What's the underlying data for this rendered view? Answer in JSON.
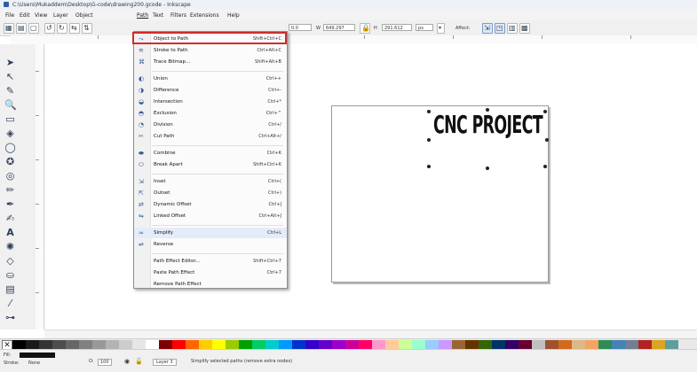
{
  "window": {
    "title": "C:\\Users\\Mukaddem\\Desktop\\G-code\\drawing200.gcode - Inkscape"
  },
  "menubar": [
    "File",
    "Edit",
    "View",
    "Layer",
    "Object",
    "Path",
    "Text",
    "Filters",
    "Extensions",
    "Help"
  ],
  "toolbar": {
    "x_value": "0.0",
    "w_label": "W",
    "w_value": "649.297",
    "h_label": "H",
    "h_value": "291.612",
    "unit": "px",
    "affect_label": "Affect:"
  },
  "path_menu": [
    {
      "label": "Object to Path",
      "shortcut": "Shift+Ctrl+C",
      "icon": "object-to-path-icon"
    },
    {
      "label": "Stroke to Path",
      "shortcut": "Ctrl+Alt+C",
      "icon": "stroke-to-path-icon"
    },
    {
      "label": "Trace Bitmap...",
      "shortcut": "Shift+Alt+B",
      "icon": "trace-bitmap-icon"
    },
    {
      "sep": true
    },
    {
      "label": "Union",
      "shortcut": "Ctrl++",
      "icon": "union-icon"
    },
    {
      "label": "Difference",
      "shortcut": "Ctrl+-",
      "icon": "difference-icon"
    },
    {
      "label": "Intersection",
      "shortcut": "Ctrl+*",
      "icon": "intersection-icon"
    },
    {
      "label": "Exclusion",
      "shortcut": "Ctrl+^",
      "icon": "exclusion-icon"
    },
    {
      "label": "Division",
      "shortcut": "Ctrl+/",
      "icon": "division-icon"
    },
    {
      "label": "Cut Path",
      "shortcut": "Ctrl+Alt+/",
      "icon": "cut-path-icon"
    },
    {
      "sep": true
    },
    {
      "label": "Combine",
      "shortcut": "Ctrl+K",
      "icon": "combine-icon"
    },
    {
      "label": "Break Apart",
      "shortcut": "Shift+Ctrl+K",
      "icon": "break-apart-icon"
    },
    {
      "sep": true
    },
    {
      "label": "Inset",
      "shortcut": "Ctrl+(",
      "icon": "inset-icon"
    },
    {
      "label": "Outset",
      "shortcut": "Ctrl+)",
      "icon": "outset-icon"
    },
    {
      "label": "Dynamic Offset",
      "shortcut": "Ctrl+J",
      "icon": "dynamic-offset-icon"
    },
    {
      "label": "Linked Offset",
      "shortcut": "Ctrl+Alt+J",
      "icon": "linked-offset-icon"
    },
    {
      "sep": true
    },
    {
      "label": "Simplify",
      "shortcut": "Ctrl+L",
      "icon": "simplify-icon"
    },
    {
      "label": "Reverse",
      "shortcut": "",
      "icon": "reverse-icon"
    },
    {
      "sep": true
    },
    {
      "label": "Path Effect Editor...",
      "shortcut": "Shift+Ctrl+7",
      "icon": ""
    },
    {
      "label": "Paste Path Effect",
      "shortcut": "Ctrl+7",
      "icon": ""
    },
    {
      "label": "Remove Path Effect",
      "shortcut": "",
      "icon": ""
    }
  ],
  "canvas": {
    "text": "CNC PROJECT"
  },
  "statusbar": {
    "fill_label": "Fill:",
    "stroke_label": "Stroke:",
    "stroke_value": "None",
    "opacity_label": "O:",
    "opacity_value": "100",
    "layer": "Layer 3",
    "message": "Simplify selected paths (remove extra nodes)"
  },
  "palette_colors": [
    "#000000",
    "#1a1a1a",
    "#333333",
    "#4d4d4d",
    "#666666",
    "#808080",
    "#999999",
    "#b3b3b3",
    "#cccccc",
    "#e6e6e6",
    "#ffffff",
    "#800000",
    "#ff0000",
    "#ff6600",
    "#ffcc00",
    "#ffff00",
    "#99cc00",
    "#00a000",
    "#00cc66",
    "#00cccc",
    "#0099ff",
    "#0033cc",
    "#3300cc",
    "#6600cc",
    "#9900cc",
    "#cc0099",
    "#ff0066",
    "#ff99cc",
    "#ffcc99",
    "#ccff99",
    "#99ffcc",
    "#99ccff",
    "#cc99ff",
    "#996633",
    "#663300",
    "#336600",
    "#003366",
    "#330066",
    "#660033",
    "#c0c0c0",
    "#a0522d",
    "#d2691e",
    "#deb887",
    "#f4a460",
    "#2e8b57",
    "#4682b4",
    "#708090",
    "#b22222",
    "#daa520",
    "#5f9ea0"
  ]
}
